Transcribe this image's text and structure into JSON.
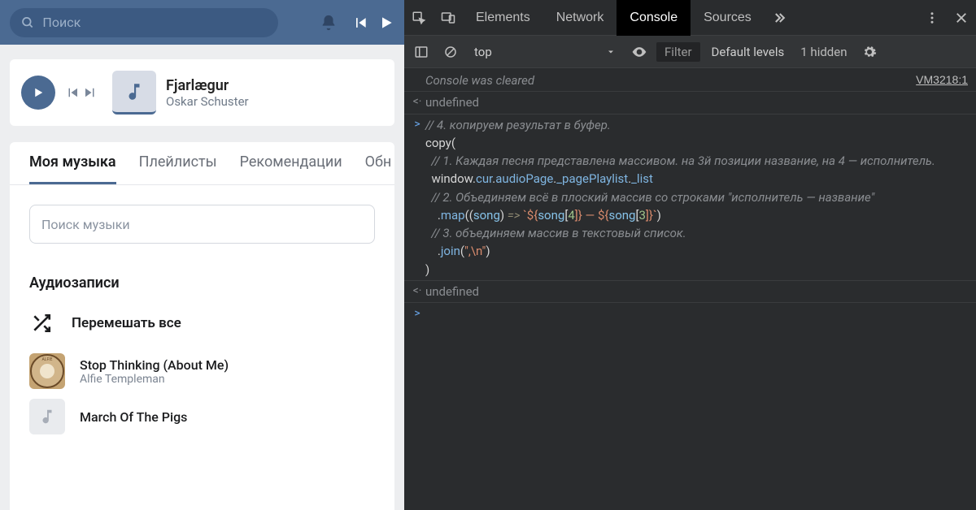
{
  "vk": {
    "search_placeholder": "Поиск",
    "now_playing": {
      "title": "Fjarlægur",
      "artist": "Oskar Schuster"
    },
    "tabs": [
      "Моя музыка",
      "Плейлисты",
      "Рекомендации",
      "Обн"
    ],
    "active_tab": 0,
    "inner_search_placeholder": "Поиск музыки",
    "section_title": "Аудиозаписи",
    "shuffle_label": "Перемешать все",
    "tracks": [
      {
        "title": "Stop Thinking (About Me)",
        "artist": "Alfie Templeman"
      },
      {
        "title": "March Of The Pigs",
        "artist": ""
      }
    ]
  },
  "devtools": {
    "tabs": [
      "Elements",
      "Network",
      "Console",
      "Sources"
    ],
    "active_tab": 2,
    "toolbar": {
      "context": "top",
      "filter_placeholder": "Filter",
      "levels": "Default levels",
      "hidden": "1 hidden"
    },
    "console": {
      "cleared_msg": "Console was cleared",
      "cleared_link": "VM3218:1",
      "undef": "undefined",
      "code": {
        "l1": "// 4. копируем результат в буфер.",
        "l2": "copy(",
        "l3": "  // 1. Каждая песня представлена массивом. на 3й позиции название, на 4 — исполнитель.",
        "l4_a": "  window.",
        "l4_b": "cur",
        "l4_c": ".",
        "l4_d": "audioPage",
        "l4_e": ".",
        "l4_f": "_pagePlaylist",
        "l4_g": ".",
        "l4_h": "_list",
        "l5": "  // 2. Объединяем всё в плоский массив со строками \"исполнитель — название\"",
        "l6_a": "    .",
        "l6_b": "map",
        "l6_c": "((",
        "l6_d": "song",
        "l6_e": ") ",
        "l6_f": "=>",
        "l6_g": " `${",
        "l6_h": "song",
        "l6_i": "[",
        "l6_j": "4",
        "l6_k": "]} — ${",
        "l6_l": "song",
        "l6_m": "[",
        "l6_n": "3",
        "l6_o": "]}`",
        "l6_p": ")",
        "l7": "  // 3. объединяем массив в текстовый список.",
        "l8_a": "    .",
        "l8_b": "join",
        "l8_c": "(",
        "l8_d": "\",\\n\"",
        "l8_e": ")",
        "l9": ")"
      }
    }
  }
}
